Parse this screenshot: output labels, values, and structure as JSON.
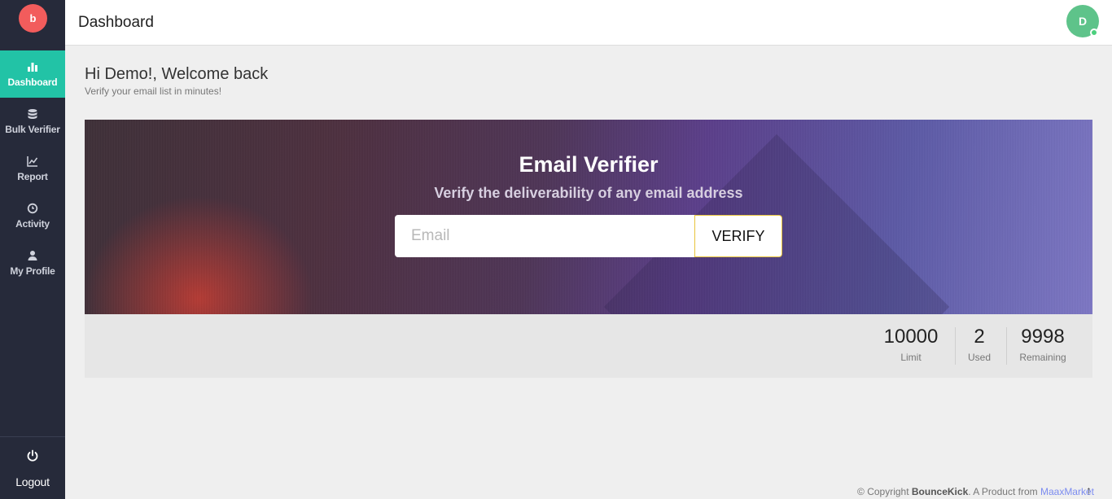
{
  "sidebar": {
    "logo_text": "b",
    "items": [
      {
        "label": "Dashboard",
        "icon": "bar-chart-icon"
      },
      {
        "label": "Bulk Verifier",
        "icon": "database-icon"
      },
      {
        "label": "Report",
        "icon": "line-chart-icon"
      },
      {
        "label": "Activity",
        "icon": "clock-icon"
      },
      {
        "label": "My Profile",
        "icon": "user-icon"
      }
    ],
    "logout_label": "Logout",
    "active_color": "#22c3a6",
    "bg_color": "#262a3a"
  },
  "header": {
    "title": "Dashboard",
    "avatar_initial": "D"
  },
  "welcome": {
    "title": "Hi Demo!, Welcome back",
    "subtitle": "Verify your email list in minutes!"
  },
  "verifier": {
    "title": "Email Verifier",
    "subtitle": "Verify the deliverability of any email address",
    "input_placeholder": "Email",
    "input_value": "",
    "button_label": "VERIFY"
  },
  "stats": [
    {
      "value": "10000",
      "label": "Limit"
    },
    {
      "value": "2",
      "label": "Used"
    },
    {
      "value": "9998",
      "label": "Remaining"
    }
  ],
  "footer": {
    "prefix": "© Copyright ",
    "brand": "BounceKick",
    "middle": ". A Product from ",
    "link": "MaaxMarket",
    "arrow": "↑"
  }
}
